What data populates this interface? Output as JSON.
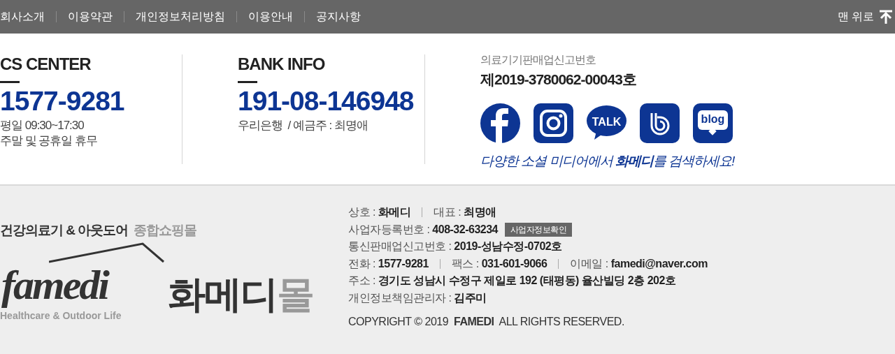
{
  "top_nav": {
    "links": [
      "회사소개",
      "이용약관",
      "개인정보처리방침",
      "이용안내",
      "공지사항"
    ],
    "to_top": "맨 위로"
  },
  "cs_center": {
    "title": "CS CENTER",
    "phone": "1577-9281",
    "hours": [
      "평일 09:30~17:30",
      "주말 및 공휴일 휴무"
    ]
  },
  "bank_info": {
    "title": "BANK INFO",
    "account": "191-08-146948",
    "holder": "우리은행  / 예금주 : 최명애"
  },
  "medical_license": {
    "label": "의료기기판매업신고번호",
    "number": "제2019-3780062-00043호"
  },
  "social": [
    {
      "kind": "facebook"
    },
    {
      "kind": "instagram"
    },
    {
      "kind": "talk",
      "text": "TALK"
    },
    {
      "kind": "band"
    },
    {
      "kind": "blog",
      "text": "blog"
    }
  ],
  "social_caption": "다양한 소셜 미디어에서 **화메디**를 검색하세요!",
  "brand": {
    "slogan": "건강의료기 & 아웃도어",
    "slogan_accent": "종합쇼핑몰",
    "wordmark": "famedi",
    "tagline": "Healthcare & Outdoor Life",
    "name": "화메디",
    "name_accent": "몰"
  },
  "company_info": [
    {
      "items": [
        "상호 : **화메디**",
        "대표 : **최명애**"
      ]
    },
    {
      "items": [
        "사업자등록번호 : **408-32-63234**"
      ],
      "button": "사업자정보확인"
    },
    {
      "items": [
        "통신판매업신고번호 : **2019-성남수정-0702호**"
      ]
    },
    {
      "items": [
        "전화 : **1577-9281**",
        "팩스 : **031-601-9066**",
        "이메일 : **famedi@naver.com**"
      ]
    },
    {
      "items": [
        "주소 : **경기도 성남시 수정구 제일로 192 (태평동) 율산빌딩 2층 202호**"
      ]
    },
    {
      "items": [
        "개인정보책임관리자 : **김주미**"
      ]
    }
  ],
  "copyright": "COPYRIGHT © 2019  **FAMEDI**  ALL RIGHTS RESERVED."
}
